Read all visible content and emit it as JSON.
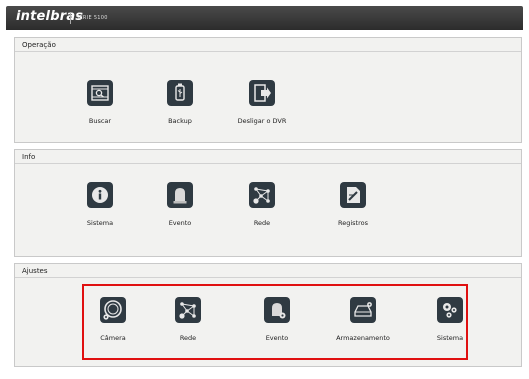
{
  "header": {
    "brand": "intelbras",
    "series": "SÉRIE 5100"
  },
  "sections": [
    {
      "title": "Operação",
      "items": [
        {
          "label": "Buscar",
          "icon": "search-icon"
        },
        {
          "label": "Backup",
          "icon": "usb-icon"
        },
        {
          "label": "Desligar o DVR",
          "icon": "logout-icon"
        }
      ]
    },
    {
      "title": "Info",
      "items": [
        {
          "label": "Sistema",
          "icon": "info-icon"
        },
        {
          "label": "Evento",
          "icon": "alarm-light-icon"
        },
        {
          "label": "Rede",
          "icon": "network-icon"
        },
        {
          "label": "Registros",
          "icon": "log-icon"
        }
      ]
    },
    {
      "title": "Ajustes",
      "items": [
        {
          "label": "Câmera",
          "icon": "camera-icon"
        },
        {
          "label": "Rede",
          "icon": "network-settings-icon"
        },
        {
          "label": "Evento",
          "icon": "event-settings-icon"
        },
        {
          "label": "Armazenamento",
          "icon": "storage-icon"
        },
        {
          "label": "Sistema",
          "icon": "gears-icon"
        }
      ]
    }
  ],
  "colors": {
    "highlight": "#e01010",
    "icon_bg": "#2f3a42"
  }
}
